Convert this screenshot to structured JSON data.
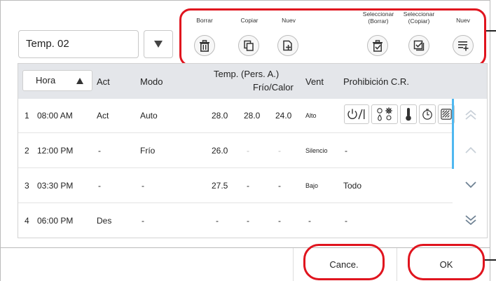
{
  "schedule": {
    "name": "Temp. 02"
  },
  "toolbar": {
    "borrar": "Borrar",
    "copiar": "Copiar",
    "nuevo": "Nuev",
    "sel_borrar_1": "Seleccionar",
    "sel_borrar_2": "(Borrar)",
    "sel_copiar_1": "Seleccionar",
    "sel_copiar_2": "(Copiar)",
    "nuevo2": "Nuev"
  },
  "table": {
    "headers": {
      "hora": "Hora",
      "act": "Act",
      "modo": "Modo",
      "temp_1": "Temp. (Pers. A.)",
      "temp_2": "Frío/Calor",
      "vent": "Vent",
      "prohib": "Prohibición C.R."
    },
    "rows": [
      {
        "num": "1",
        "time": "08:00 AM",
        "act": "Act",
        "mode": "Auto",
        "t1": "28.0",
        "t2": "28.0",
        "t3": "24.0",
        "fan": "Alto",
        "prohib": ""
      },
      {
        "num": "2",
        "time": "12:00 PM",
        "act": "-",
        "mode": "Frío",
        "t1": "26.0",
        "t2": "-",
        "t3": "-",
        "fan": "Silencio",
        "prohib": "-"
      },
      {
        "num": "3",
        "time": "03:30 PM",
        "act": "-",
        "mode": "-",
        "t1": "27.5",
        "t2": "-",
        "t3": "-",
        "fan": "Bajo",
        "prohib": "Todo"
      },
      {
        "num": "4",
        "time": "06:00 PM",
        "act": "Des",
        "mode": "-",
        "t1": "-",
        "t2": "-",
        "t3": "-",
        "fan": "-",
        "prohib": "-"
      }
    ]
  },
  "inhibit_icons": [
    "power-onoff-icon",
    "mode-icon",
    "thermometer-icon",
    "timer-icon",
    "fan-speed-icon"
  ],
  "footer": {
    "cancel": "Cance.",
    "ok": "OK"
  },
  "colors": {
    "highlight": "#e0141e",
    "scrollbar": "#4fb8f0",
    "header_bg": "#e4e6ea"
  }
}
